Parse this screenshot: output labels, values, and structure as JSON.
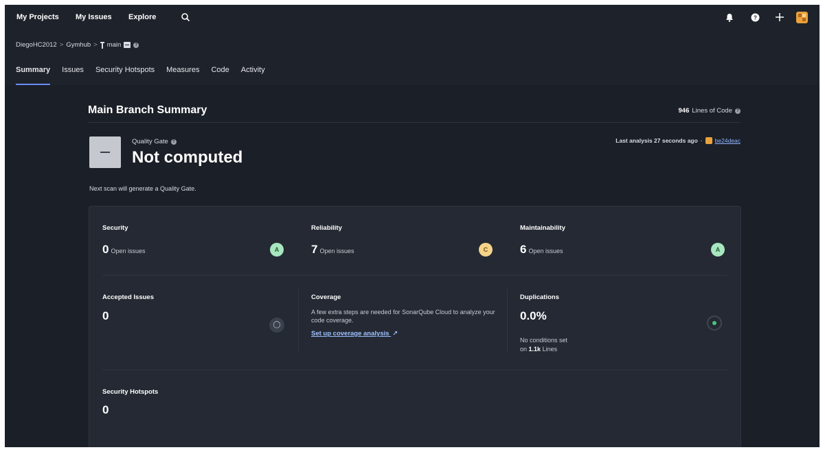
{
  "topnav": {
    "links": [
      "My Projects",
      "My Issues",
      "Explore"
    ],
    "icons": [
      "search-icon",
      "bell-icon",
      "help-icon",
      "plus-icon",
      "avatar"
    ]
  },
  "breadcrumb": {
    "organization": "DiegoHC2012",
    "project": "Gymhub",
    "branch": "main"
  },
  "tabs": [
    "Summary",
    "Issues",
    "Security Hotspots",
    "Measures",
    "Code",
    "Activity"
  ],
  "summary": {
    "title": "Main Branch Summary",
    "lines_of_code_value": "946",
    "lines_of_code_label": "Lines of Code"
  },
  "quality_gate": {
    "label": "Quality Gate",
    "status": "Not computed",
    "last_analysis": "Last analysis 27 seconds ago",
    "commit": "be24deac",
    "next_scan_note": "Next scan will generate a Quality Gate."
  },
  "metrics": {
    "security": {
      "title": "Security",
      "value": "0",
      "sub": "Open issues",
      "grade": "A"
    },
    "reliability": {
      "title": "Reliability",
      "value": "7",
      "sub": "Open issues",
      "grade": "C"
    },
    "maintainability": {
      "title": "Maintainability",
      "value": "6",
      "sub": "Open issues",
      "grade": "A"
    },
    "accepted_issues": {
      "title": "Accepted Issues",
      "value": "0"
    },
    "coverage": {
      "title": "Coverage",
      "text": "A few extra steps are needed for SonarQube Cloud to analyze your code coverage.",
      "link": "Set up coverage analysis"
    },
    "duplications": {
      "title": "Duplications",
      "value": "0.0%",
      "note_line1": "No conditions set",
      "note_on": "on",
      "note_lines_value": "1.1k",
      "note_lines_label": "Lines"
    },
    "security_hotspots": {
      "title": "Security Hotspots",
      "value": "0"
    }
  },
  "colors": {
    "background": "#1b1f27",
    "panel": "#242933",
    "grade_a": "#a8e6bf",
    "grade_c": "#f5d38a",
    "link": "#9ec0ff",
    "tab_underline": "#6b8cff"
  }
}
